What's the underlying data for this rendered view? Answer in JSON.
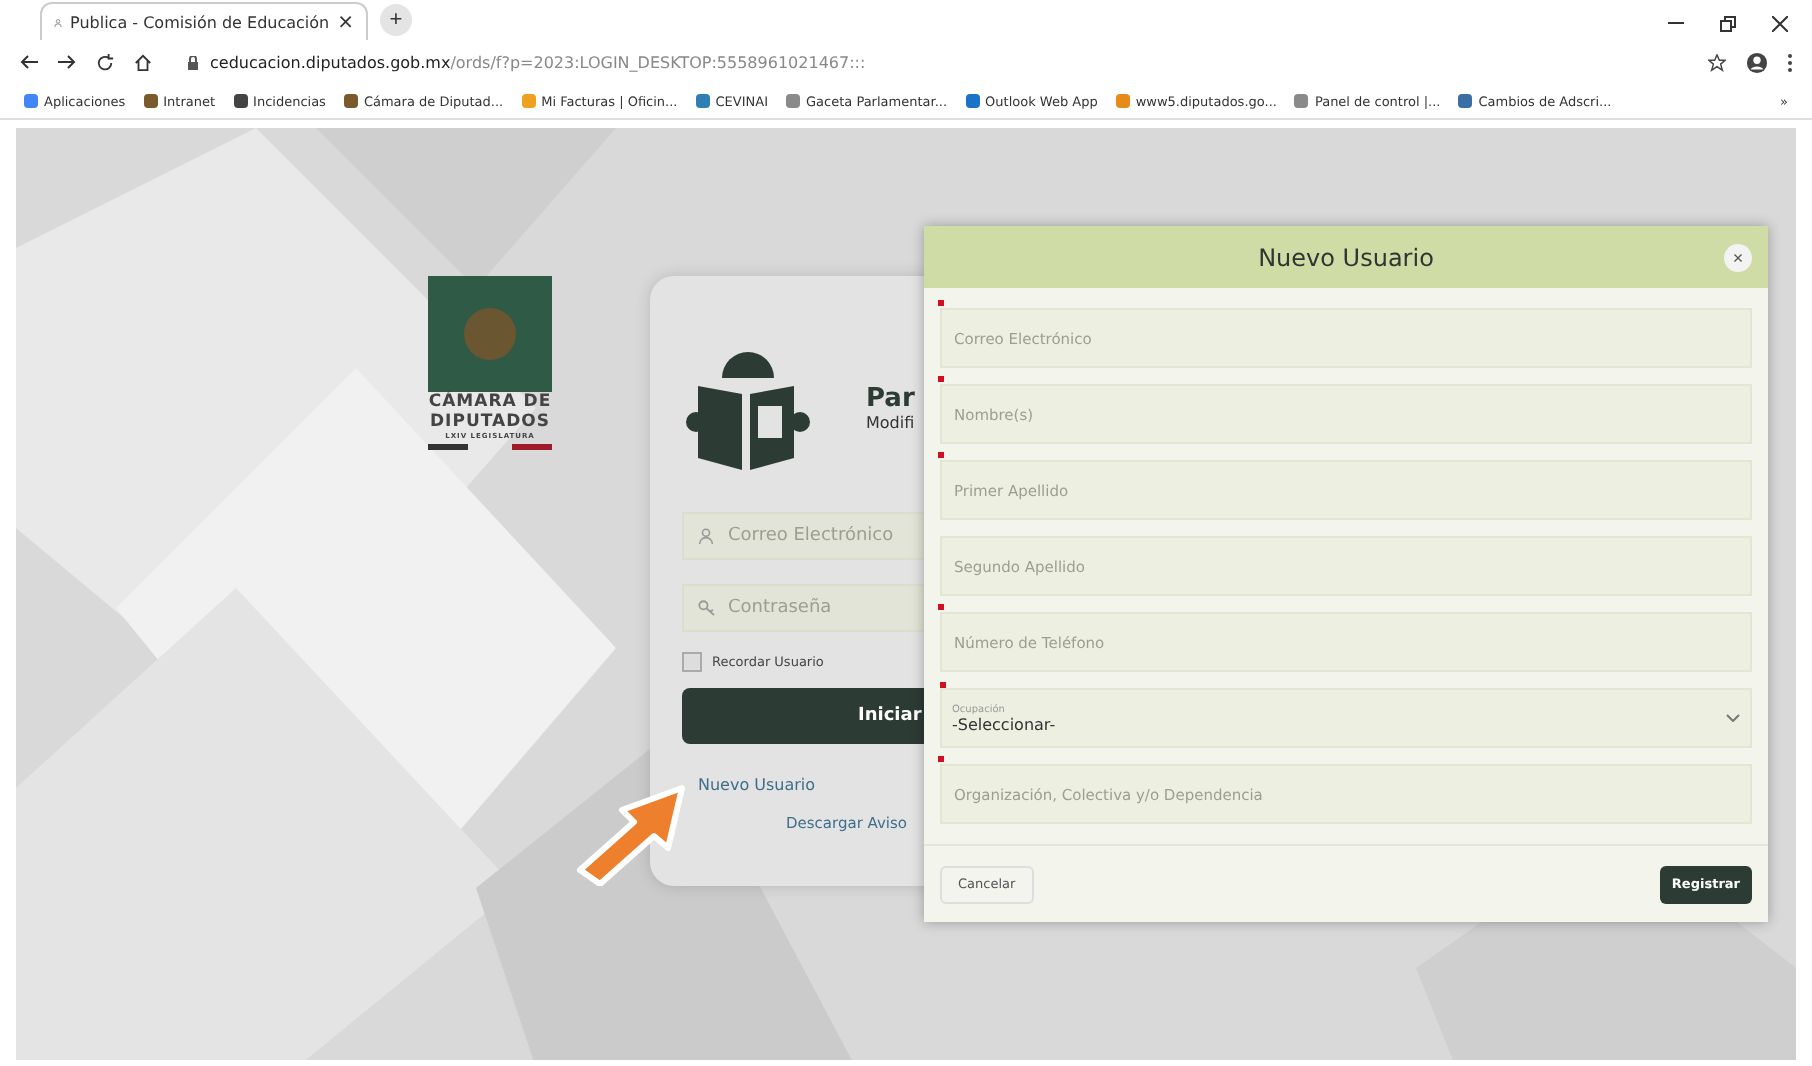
{
  "browser": {
    "tab": {
      "title": "Publica - Comisión de Educación",
      "close": "×",
      "new_tab": "+"
    },
    "address": {
      "host": "ceducacion.diputados.gob.mx",
      "path": "/ords/f?p=2023:LOGIN_DESKTOP:5558961021467:::"
    },
    "bookmarks": [
      {
        "label": "Aplicaciones",
        "color": "#4285f4"
      },
      {
        "label": "Intranet",
        "color": "#7a5a2a"
      },
      {
        "label": "Incidencias",
        "color": "#444444"
      },
      {
        "label": "Cámara de Diputad...",
        "color": "#7a5a2a"
      },
      {
        "label": "Mi Facturas | Oficin...",
        "color": "#f0a020"
      },
      {
        "label": "CEVINAI",
        "color": "#2f7fb5"
      },
      {
        "label": "Gaceta Parlamentar...",
        "color": "#8a8a8a"
      },
      {
        "label": "Outlook Web App",
        "color": "#1a73c9"
      },
      {
        "label": "www5.diputados.go...",
        "color": "#e88a1a"
      },
      {
        "label": "Panel de control |...",
        "color": "#8a8a8a"
      },
      {
        "label": "Cambios de Adscri...",
        "color": "#3a6ea5"
      }
    ],
    "more": "»"
  },
  "logo": {
    "line1": "CÁMARA DE",
    "line2": "DIPUTADOS",
    "line3": "LXIV LEGISLATURA"
  },
  "login": {
    "title": "Par",
    "subtitle": "Modifi",
    "fields": [
      {
        "placeholder": "Correo Electrónico",
        "kind": "user"
      },
      {
        "placeholder": "Contraseña",
        "kind": "key"
      }
    ],
    "remember": {
      "label": "Recordar Usuario",
      "checked": false
    },
    "submit": "Iniciar",
    "new_user": "Nuevo Usuario",
    "download": "Descargar Aviso"
  },
  "modal": {
    "title": "Nuevo Usuario",
    "close": "×",
    "fields": [
      {
        "kind": "input",
        "placeholder": "Correo Electrónico",
        "required": true
      },
      {
        "kind": "input",
        "placeholder": "Nombre(s)",
        "required": true
      },
      {
        "kind": "input",
        "placeholder": "Primer Apellido",
        "required": true
      },
      {
        "kind": "input",
        "placeholder": "Segundo Apellido",
        "required": false
      },
      {
        "kind": "input",
        "placeholder": "Número de Teléfono",
        "required": true
      },
      {
        "kind": "select",
        "label": "Ocupación",
        "value": "-Seleccionar-",
        "required": true
      },
      {
        "kind": "input",
        "placeholder": "Organización, Colectiva y/o Dependencia",
        "required": true
      }
    ],
    "cancel": "Cancelar",
    "submit": "Registrar"
  }
}
